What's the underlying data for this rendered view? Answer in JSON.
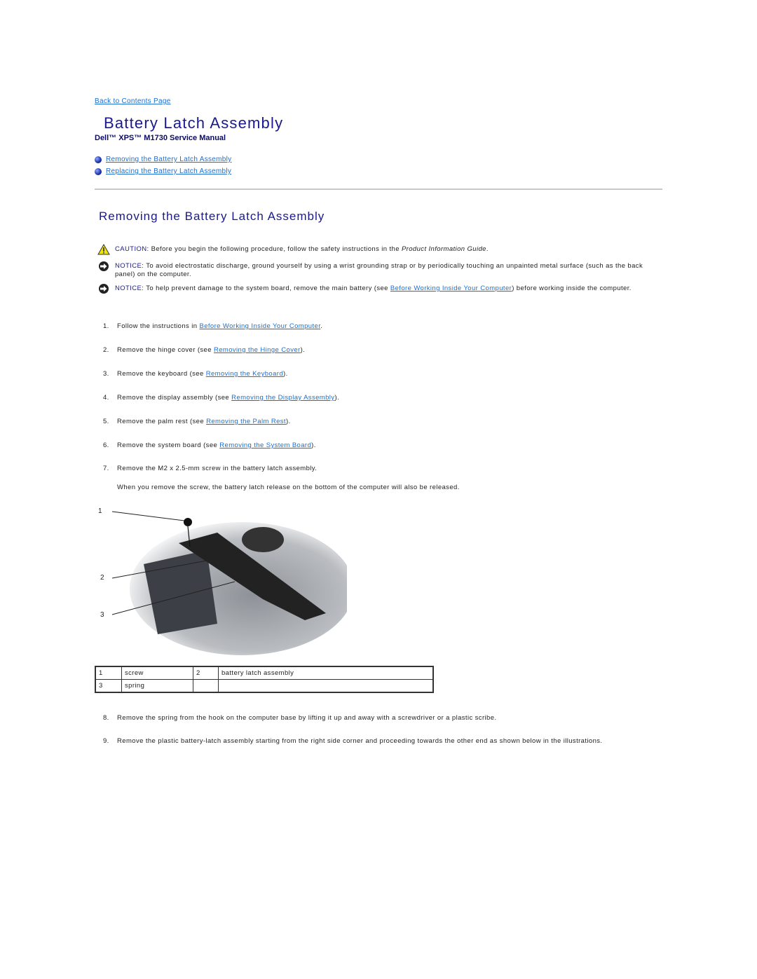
{
  "nav": {
    "back_link": "Back to Contents Page"
  },
  "header": {
    "title": "Battery Latch Assembly",
    "subtitle": "Dell™ XPS™ M1730 Service Manual"
  },
  "toc": [
    {
      "label": "Removing the Battery Latch Assembly"
    },
    {
      "label": "Replacing the Battery Latch Assembly"
    }
  ],
  "section": {
    "title": "Removing the Battery Latch Assembly",
    "caution": {
      "icon": "warning-triangle-icon",
      "label": "CAUTION:",
      "text": " Before you begin the following procedure, follow the safety instructions in the ",
      "emphasis": "Product Information Guide",
      "end": "."
    },
    "notice1": {
      "icon": "notice-arrow-icon",
      "label": "NOTICE:",
      "text": " To avoid electrostatic discharge, ground yourself by using a wrist grounding strap or by periodically touching an unpainted metal surface (such as the back panel) on the computer."
    },
    "notice2": {
      "icon": "notice-arrow-icon",
      "label": "NOTICE:",
      "pre": " To help prevent damage to the system board, remove the main battery (see ",
      "link": "Before Working Inside Your Computer",
      "post": ") before working inside the computer."
    },
    "steps": [
      {
        "num": "1.",
        "pre": "Follow the instructions in ",
        "link": "Before Working Inside Your Computer",
        "post": "."
      },
      {
        "num": "2.",
        "pre": "Remove the hinge cover (see ",
        "link": "Removing the Hinge Cover",
        "post": ")."
      },
      {
        "num": "3.",
        "pre": "Remove the keyboard (see ",
        "link": "Removing the Keyboard",
        "post": ")."
      },
      {
        "num": "4.",
        "pre": "Remove the display assembly (see ",
        "link": "Removing the Display Assembly",
        "post": ")."
      },
      {
        "num": "5.",
        "pre": "Remove the palm rest (see ",
        "link": "Removing the Palm Rest",
        "post": ")."
      },
      {
        "num": "6.",
        "pre": "Remove the system board (see ",
        "link": "Removing the System Board",
        "post": ")."
      },
      {
        "num": "7.",
        "pre": "Remove the M2 x 2.5-mm screw in the battery latch assembly.",
        "link": "",
        "post": ""
      },
      {
        "num": "8.",
        "pre": "Remove the spring from the hook on the computer base by lifting it up and away with a screwdriver or a plastic scribe.",
        "link": "",
        "post": ""
      },
      {
        "num": "9.",
        "pre": "Remove the plastic battery-latch assembly starting from the right side corner and proceeding towards the other end as shown below in the illustrations.",
        "link": "",
        "post": ""
      }
    ],
    "step7_note": "When you remove the screw, the battery latch release on the bottom of the computer will also be released.",
    "figure": {
      "callouts": [
        "1",
        "2",
        "3"
      ]
    },
    "legend": [
      [
        "1",
        "screw",
        "2",
        "battery latch assembly"
      ],
      [
        "3",
        "spring",
        "",
        ""
      ]
    ]
  }
}
